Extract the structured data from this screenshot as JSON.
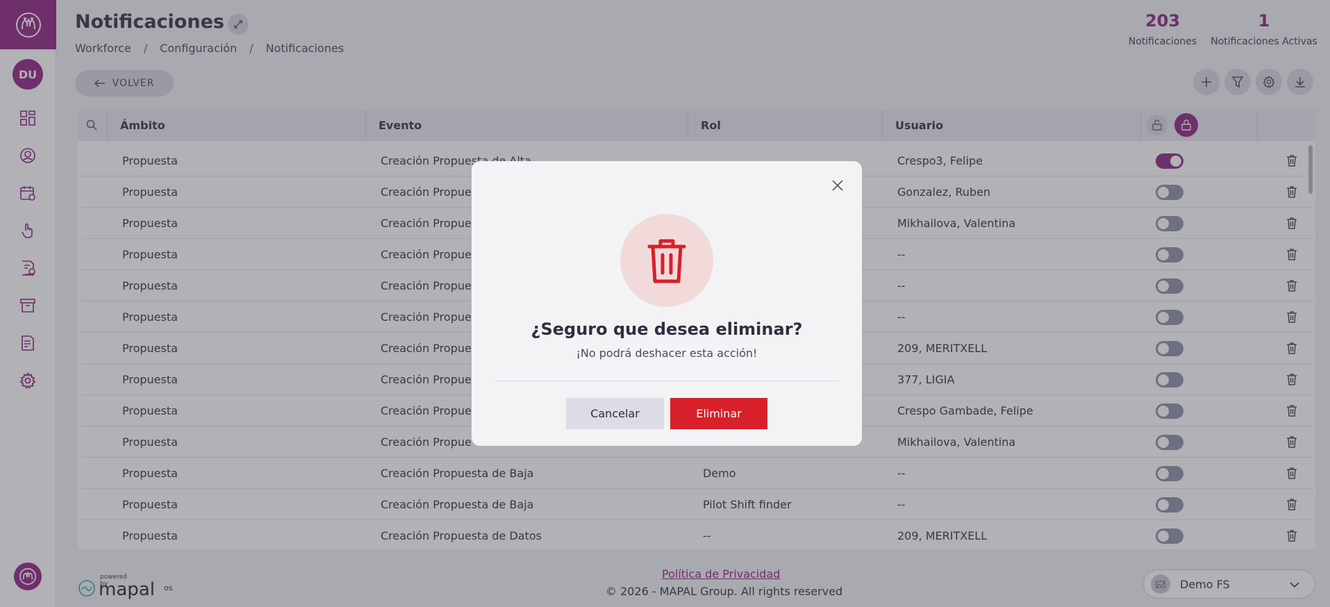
{
  "header": {
    "title": "Notificaciones",
    "breadcrumb": [
      "Workforce",
      "Configuración",
      "Notificaciones"
    ],
    "stats": [
      {
        "value": "203",
        "label": "Notificaciones"
      },
      {
        "value": "1",
        "label": "Notificaciones Activas"
      }
    ]
  },
  "sidebar": {
    "avatar_initials": "DU",
    "items": [
      "dashboard-icon",
      "user-icon",
      "calendar-icon",
      "touch-icon",
      "document-clock-icon",
      "archive-icon",
      "report-icon",
      "gear-icon"
    ]
  },
  "toolbar": {
    "back_label": "VOLVER"
  },
  "table": {
    "columns": [
      "Ámbito",
      "Evento",
      "Rol",
      "Usuario"
    ],
    "rows": [
      {
        "ambito": "Propuesta",
        "evento": "Creación Propuesta de Alta",
        "rol": "",
        "usuario": "Crespo3, Felipe",
        "active": true
      },
      {
        "ambito": "Propuesta",
        "evento": "Creación Propue",
        "rol": "",
        "usuario": "Gonzalez, Ruben",
        "active": false
      },
      {
        "ambito": "Propuesta",
        "evento": "Creación Propue",
        "rol": "",
        "usuario": "Mikhailova, Valentina",
        "active": false
      },
      {
        "ambito": "Propuesta",
        "evento": "Creación Propue",
        "rol": "",
        "usuario": "--",
        "active": false
      },
      {
        "ambito": "Propuesta",
        "evento": "Creación Propue",
        "rol": "",
        "usuario": "--",
        "active": false
      },
      {
        "ambito": "Propuesta",
        "evento": "Creación Propue",
        "rol": "",
        "usuario": "--",
        "active": false
      },
      {
        "ambito": "Propuesta",
        "evento": "Creación Propue",
        "rol": "",
        "usuario": "209, MERITXELL",
        "active": false
      },
      {
        "ambito": "Propuesta",
        "evento": "Creación Propue",
        "rol": "",
        "usuario": "377, LIGIA",
        "active": false
      },
      {
        "ambito": "Propuesta",
        "evento": "Creación Propue",
        "rol": "",
        "usuario": "Crespo Gambade, Felipe",
        "active": false
      },
      {
        "ambito": "Propuesta",
        "evento": "Creación Propue",
        "rol": "",
        "usuario": "Mikhailova, Valentina",
        "active": false
      },
      {
        "ambito": "Propuesta",
        "evento": "Creación Propuesta de Baja",
        "rol": "Demo",
        "usuario": "--",
        "active": false
      },
      {
        "ambito": "Propuesta",
        "evento": "Creación Propuesta de Baja",
        "rol": "Pilot Shift finder",
        "usuario": "--",
        "active": false
      },
      {
        "ambito": "Propuesta",
        "evento": "Creación Propuesta de Datos",
        "rol": "--",
        "usuario": "209, MERITXELL",
        "active": false
      }
    ]
  },
  "footer": {
    "privacy": "Política de Privacidad",
    "copyright": "© 2026 - MAPAL Group. All rights reserved",
    "powered_by": "powered by",
    "brand": "mapal",
    "brand_suffix": "os",
    "org": "Demo FS"
  },
  "modal": {
    "title": "¿Seguro que desea eliminar?",
    "subtitle": "¡No podrá deshacer esta acción!",
    "cancel": "Cancelar",
    "confirm": "Eliminar"
  },
  "colors": {
    "brand": "#8e1f7c",
    "danger": "#d7202a"
  }
}
